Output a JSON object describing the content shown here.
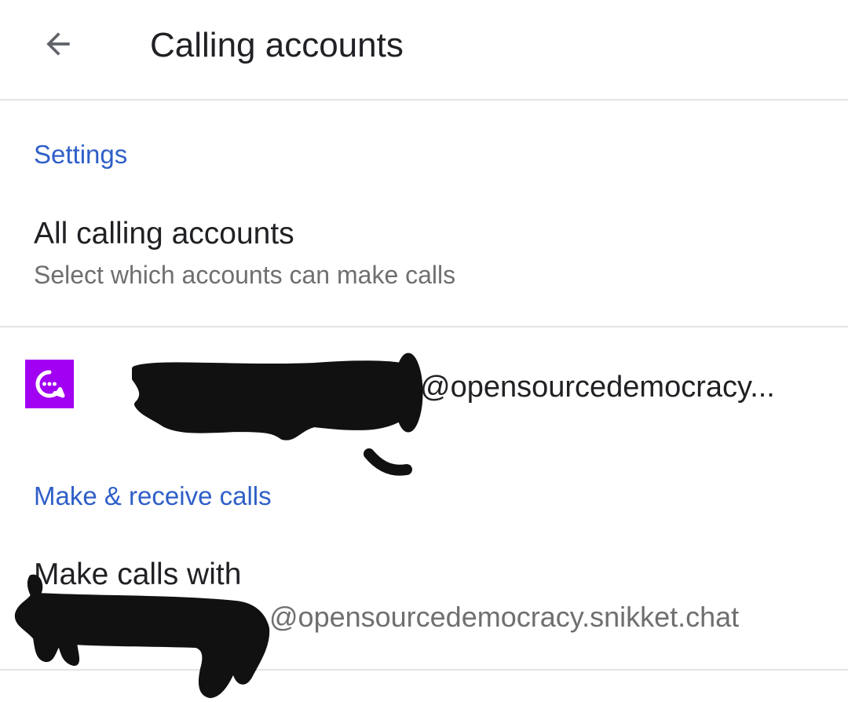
{
  "app_bar": {
    "title": "Calling accounts",
    "back_icon": "arrow-back-icon"
  },
  "settings_section": {
    "header": "Settings",
    "all_accounts": {
      "title": "All calling accounts",
      "summary": "Select which accounts can make calls"
    }
  },
  "account": {
    "icon": "snikket-chat-icon",
    "icon_color": "#a100f2",
    "name_visible": "@opensourcedemocracy..."
  },
  "calls_section": {
    "header": "Make & receive calls",
    "make_calls_with": {
      "title": "Make calls with",
      "summary_visible": "@opensourcedemocracy.snikket.chat"
    }
  },
  "colors": {
    "accent": "#2f5fc8",
    "text_primary": "#202124",
    "text_secondary": "#6f6f6f",
    "divider": "#e3e3e3"
  }
}
